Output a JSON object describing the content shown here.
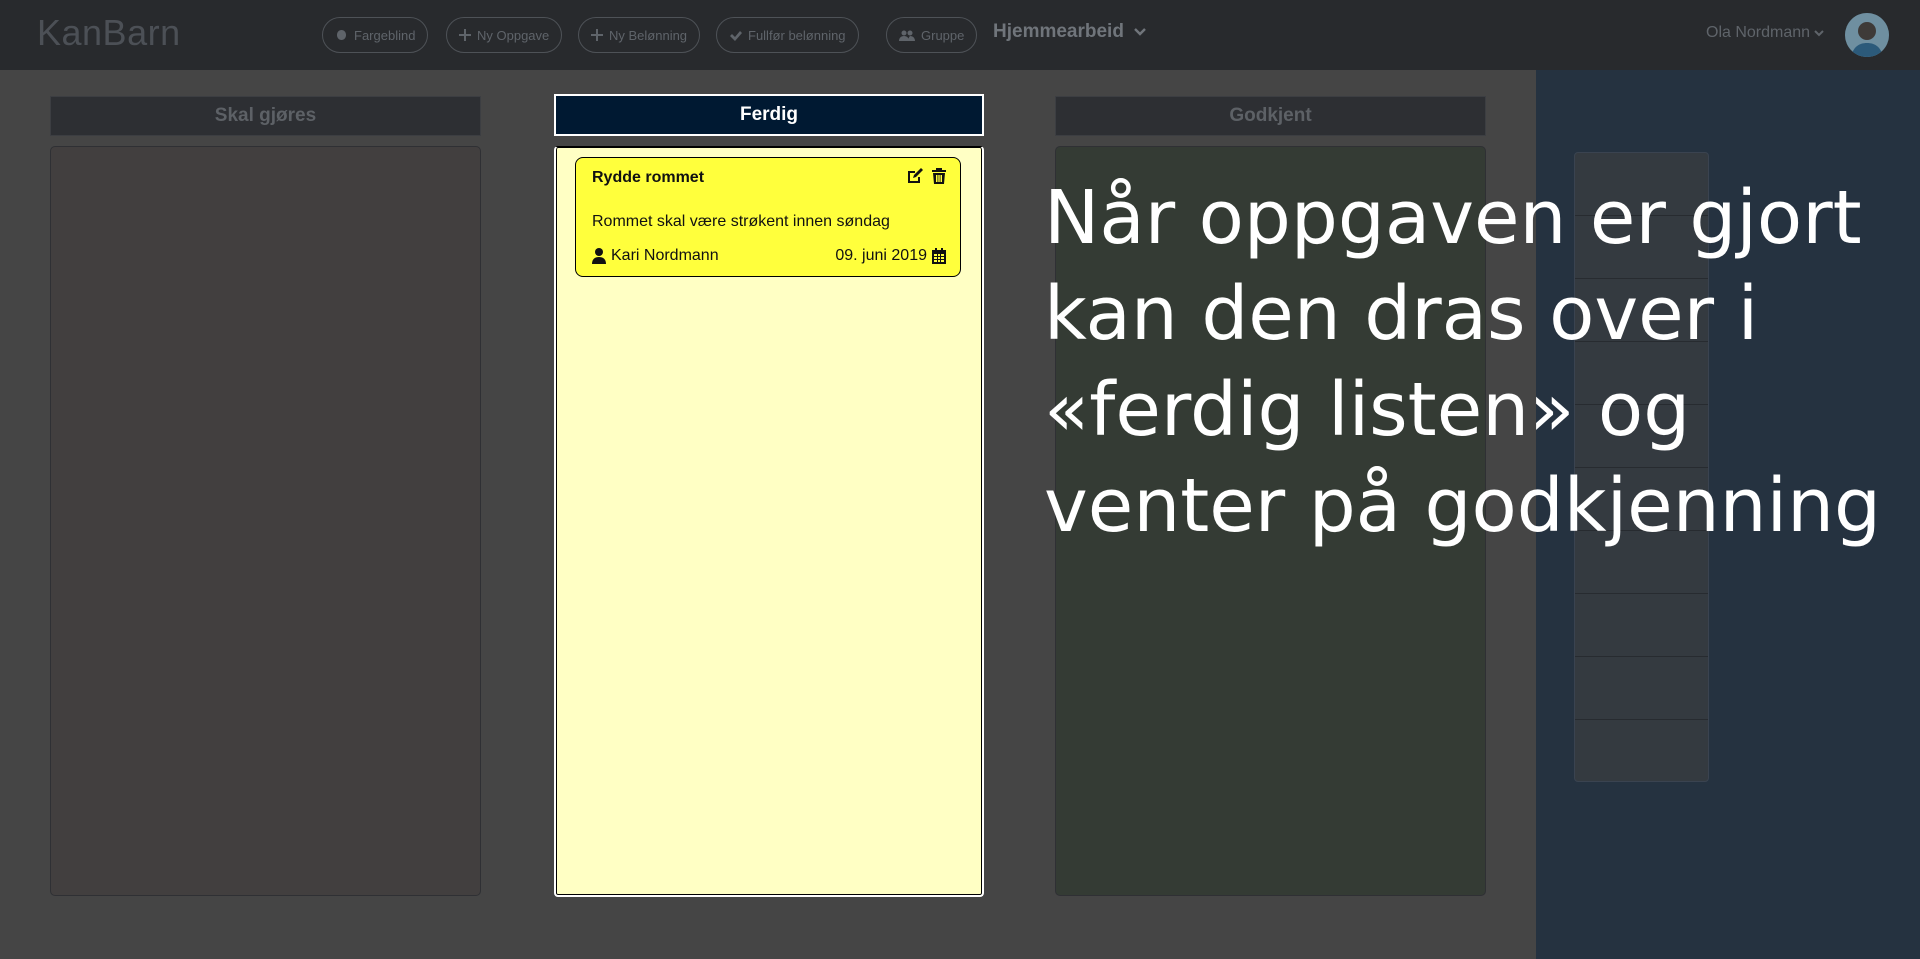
{
  "app": {
    "brand": "KanBarn"
  },
  "navbar": {
    "buttons": [
      {
        "label": "Fargeblind",
        "icon": "brain-icon"
      },
      {
        "label": "Ny Oppgave",
        "icon": "plus-icon"
      },
      {
        "label": "Ny Belønning",
        "icon": "plus-icon"
      },
      {
        "label": "Fullfør belønning",
        "icon": "check-icon"
      },
      {
        "label": "Gruppe",
        "icon": "users-icon"
      }
    ],
    "group": "Hjemmearbeid",
    "user": "Ola Nordmann"
  },
  "columns": {
    "todo": {
      "title": "Skal gjøres"
    },
    "done": {
      "title": "Ferdig"
    },
    "approved": {
      "title": "Godkjent"
    }
  },
  "card": {
    "title": "Rydde rommet",
    "description": "Rommet skal være strøkent innen søndag",
    "assignee": "Kari Nordmann",
    "due_date": "09. juni 2019"
  },
  "overlay": {
    "line1": "Når oppgaven er gjort",
    "line2": "kan den dras over i",
    "line3": "«ferdig listen» og",
    "line4": "venter på godkjenning"
  },
  "colors": {
    "navbar": "#282a2d",
    "background": "#454545",
    "ferdig_header": "#001932",
    "ferdig_body": "#ffffc4",
    "card": "#ffff3c",
    "todo_body": "#423f3f",
    "approved_body": "#343b34",
    "side_panel": "#253240"
  }
}
